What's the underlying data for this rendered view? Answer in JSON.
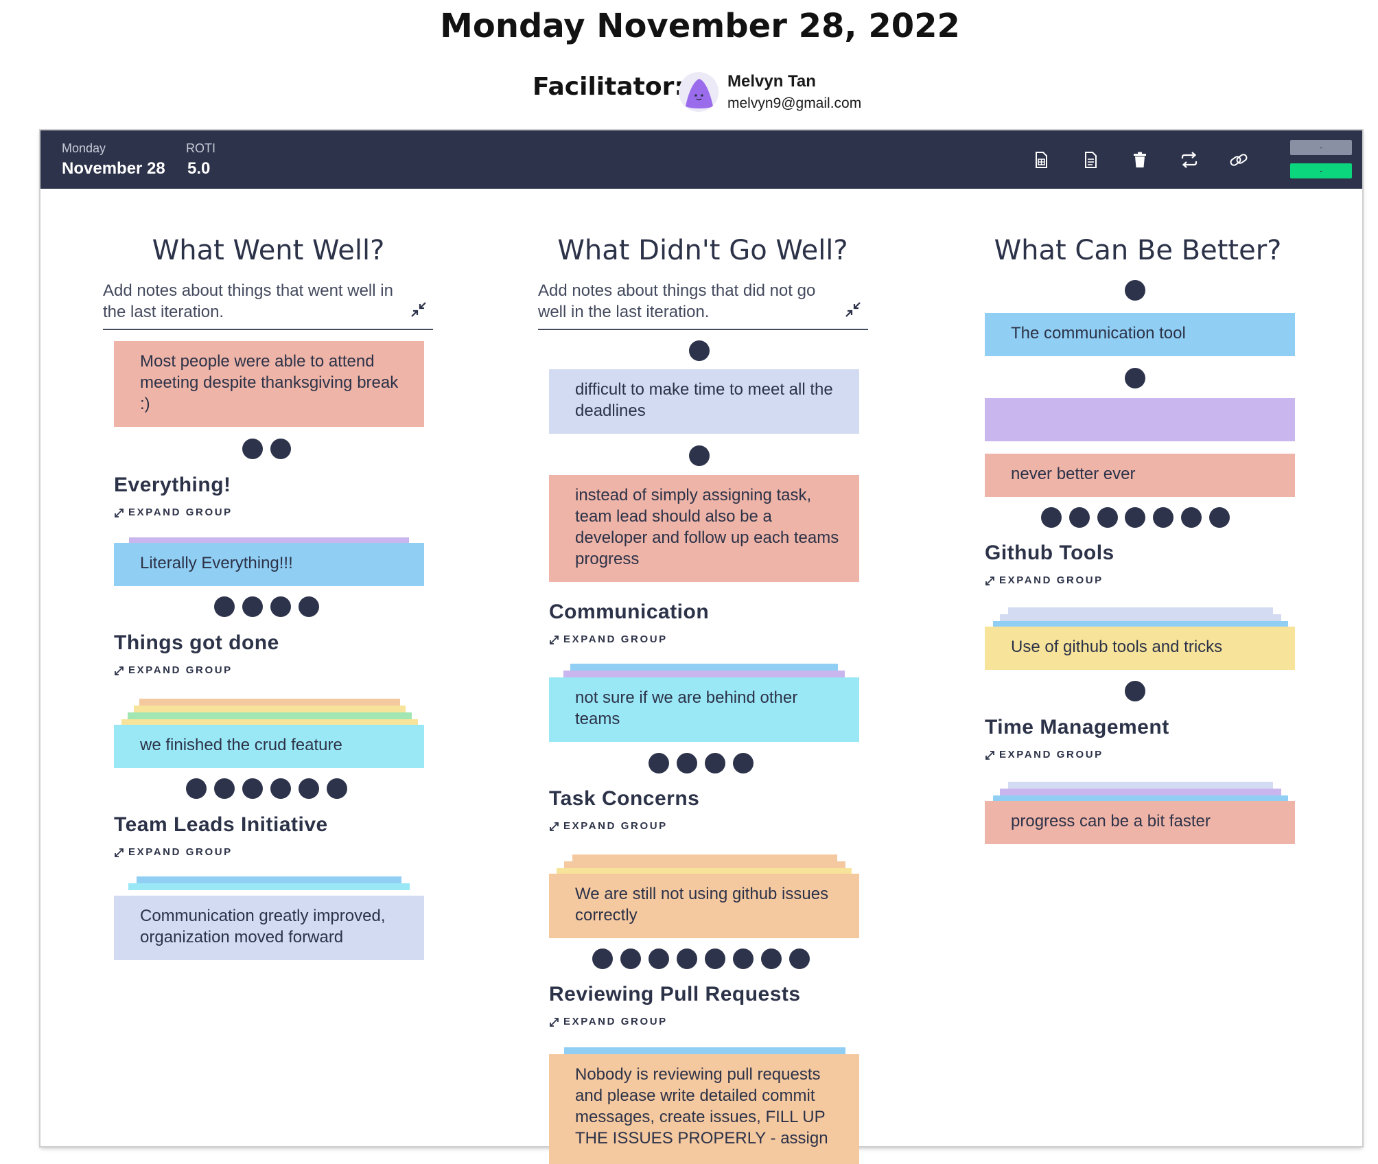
{
  "header": {
    "title": "Monday November 28, 2022",
    "facilitator_label": "Facilitator:",
    "facilitator_name": "Melvyn Tan",
    "facilitator_email": "melvyn9@gmail.com"
  },
  "bar": {
    "day": "Monday",
    "date": "November 28",
    "roti_label": "ROTI",
    "roti_value": "5.0",
    "badge_top": "-",
    "badge_bottom": "-",
    "icons": [
      "spreadsheet-icon",
      "document-icon",
      "trash-icon",
      "refresh-icon",
      "link-icon"
    ],
    "colors": {
      "bar": "#2d334b",
      "badge_top": "#8a90a4",
      "badge_bottom": "#0bd67e"
    }
  },
  "columns": [
    {
      "title": "What Went Well?",
      "description": "Add notes about things that went well in the last iteration.",
      "card1": "Most people were able to attend meeting despite thanksgiving break :)",
      "groups": [
        {
          "title": "Everything!",
          "expand": "EXPAND GROUP",
          "card": "Literally Everything!!!",
          "votes": 2
        },
        {
          "title": "Things got done",
          "expand": "EXPAND GROUP",
          "card": "we finished the crud feature",
          "votes": 4
        },
        {
          "title": "Team Leads Initiative",
          "expand": "EXPAND GROUP",
          "card": "Communication greatly improved, organization moved forward",
          "votes": 6
        }
      ]
    },
    {
      "title": "What Didn't Go Well?",
      "description": "Add notes about things that did not go well in the last iteration.",
      "card1": "difficult to make time to meet all the deadlines",
      "card2": "instead of simply assigning task, team lead should also be a developer and follow up each teams progress",
      "groups": [
        {
          "title": "Communication",
          "expand": "EXPAND GROUP",
          "card": "not sure if we are behind other teams",
          "votes": 0
        },
        {
          "title": "Task Concerns",
          "expand": "EXPAND GROUP",
          "card": "We are still not using github issues correctly",
          "votes": 4
        },
        {
          "title": "Reviewing Pull Requests",
          "expand": "EXPAND GROUP",
          "card": "Nobody is reviewing pull requests and please write detailed commit messages, create issues, FILL UP THE ISSUES PROPERLY - assign",
          "votes": 8
        }
      ]
    },
    {
      "title": "What Can Be Better?",
      "card1": "The communication tool",
      "card2": "",
      "card3": "never better ever",
      "groups": [
        {
          "title": "Github Tools",
          "expand": "EXPAND GROUP",
          "card": "Use of github tools and tricks",
          "votes": 7
        },
        {
          "title": "Time Management",
          "expand": "EXPAND GROUP",
          "card": "progress can be a bit faster",
          "votes": 1
        }
      ]
    }
  ],
  "card_colors": {
    "salmon": "#eeb4a8",
    "blue": "#90cef3",
    "cyan": "#9ae8f6",
    "lavender": "#d2dbf1",
    "purple": "#c9b6ee",
    "peach": "#f5c9a0",
    "yellow": "#f7e49a"
  }
}
